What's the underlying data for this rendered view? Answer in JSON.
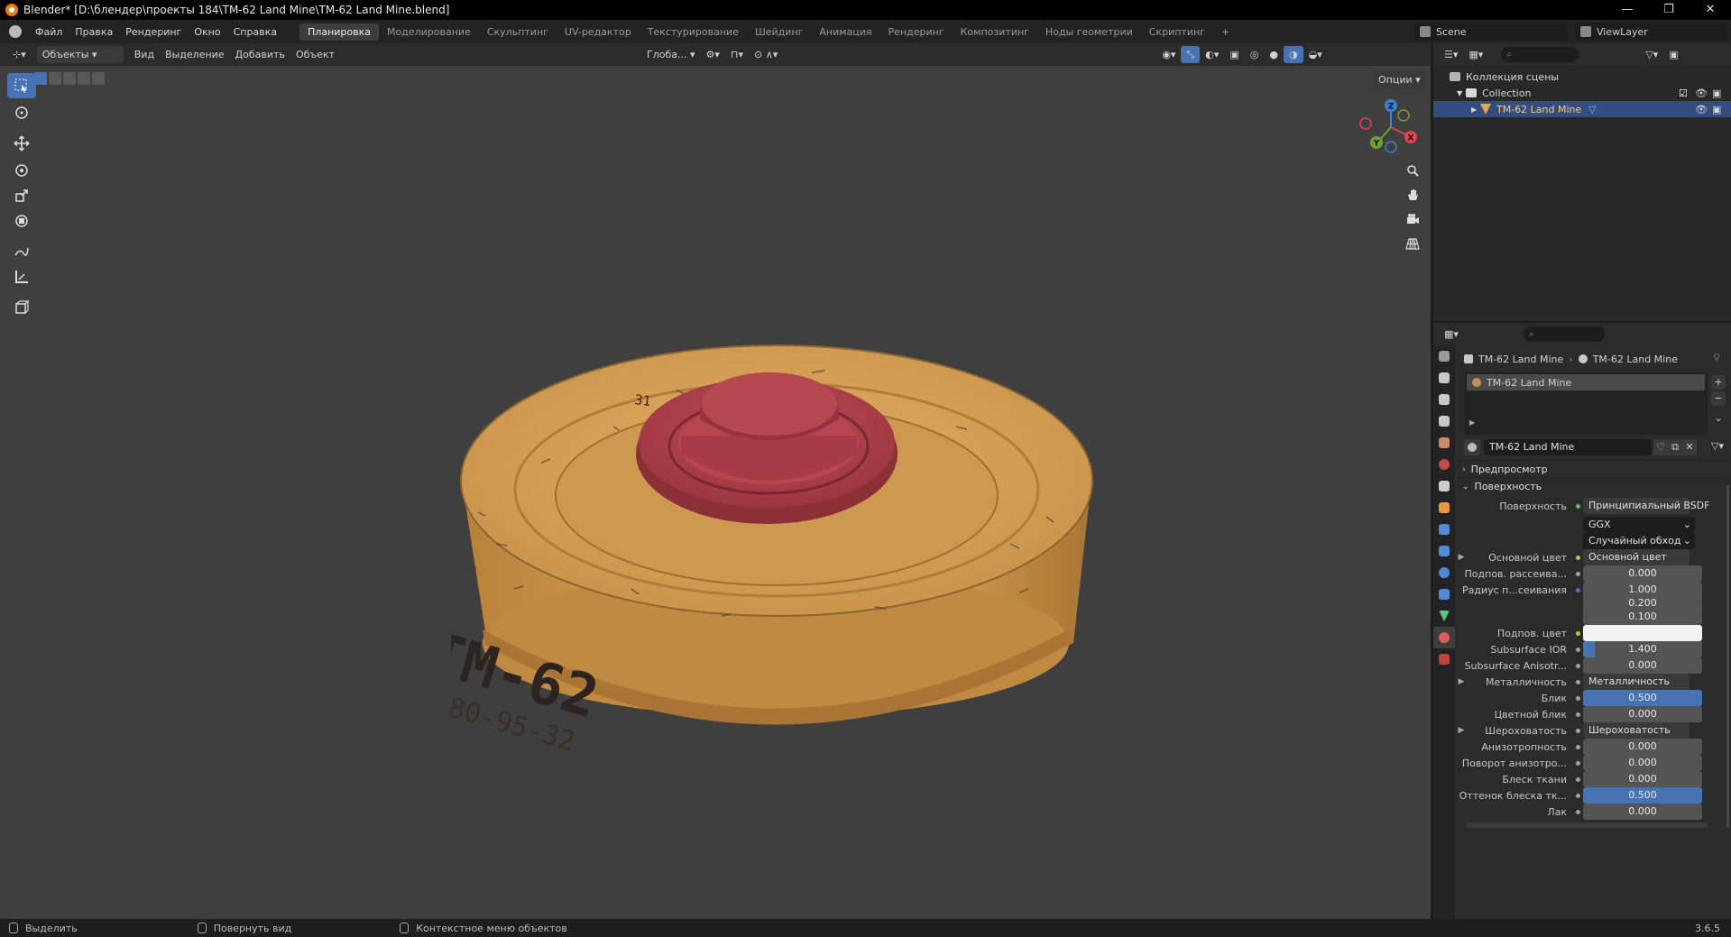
{
  "window": {
    "title": "Blender* [D:\\блендер\\проекты 184\\TM-62 Land Mine\\TM-62 Land Mine.blend]",
    "minimize_glyph": "—",
    "maximize_glyph": "❐",
    "close_glyph": "✕"
  },
  "menu": {
    "items": [
      "Файл",
      "Правка",
      "Рендеринг",
      "Окно",
      "Справка"
    ],
    "workspaces": [
      "Планировка",
      "Моделирование",
      "Скульптинг",
      "UV-редактор",
      "Текстурирование",
      "Шейдинг",
      "Анимация",
      "Рендеринг",
      "Композитинг",
      "Ноды геометрии",
      "Скриптинг"
    ],
    "active_workspace": "Планировка",
    "add_tab": "+",
    "scene": "Scene",
    "view_layer": "ViewLayer"
  },
  "viewport_header": {
    "mode": "Объекты",
    "menus": [
      "Вид",
      "Выделение",
      "Добавить",
      "Объект"
    ],
    "orientation": "Глоба...",
    "options": "Опции"
  },
  "model": {
    "label_main": "TM-62",
    "label_serial": "80-95-32",
    "label_top": "31",
    "body_color": "#d9a24e",
    "fuse_color": "#b8454c"
  },
  "gizmo": {
    "x": "X",
    "y": "Y",
    "z": "Z",
    "x_color": "#e0424f",
    "y_color": "#6ea12d",
    "z_color": "#3c82d4"
  },
  "outliner": {
    "scene_collection": "Коллекция сцены",
    "collection": "Collection",
    "object": "TM-62 Land Mine"
  },
  "properties": {
    "breadcrumb_object": "TM-62 Land Mine",
    "breadcrumb_material": "TM-62 Land Mine",
    "slot": "TM-62 Land Mine",
    "material_name": "TM-62 Land Mine",
    "section_preview": "Предпросмотр",
    "section_surface": "Поверхность",
    "rows": {
      "surface": {
        "label": "Поверхность",
        "value": "Принципиальный BSDF"
      },
      "distribution": "GGX",
      "sss_method": "Случайный обход",
      "base_color": {
        "label": "Основной цвет",
        "value": "Основной цвет"
      },
      "subsurface": {
        "label": "Подпов. рассеива...",
        "value": "0.000"
      },
      "subsurface_radius": {
        "label": "Радиус п...сеивания",
        "values": [
          "1.000",
          "0.200",
          "0.100"
        ]
      },
      "subsurface_color": {
        "label": "Подпов. цвет",
        "color": "#f2f2f2"
      },
      "subsurface_ior": {
        "label": "Subsurface IOR",
        "value": "1.400",
        "fill": 0.1
      },
      "subsurface_aniso": {
        "label": "Subsurface Anisotr...",
        "value": "0.000"
      },
      "metallic": {
        "label": "Металличность",
        "value": "Металличность"
      },
      "specular": {
        "label": "Блик",
        "value": "0.500",
        "fill": 1.0
      },
      "specular_tint": {
        "label": "Цветной блик",
        "value": "0.000"
      },
      "roughness": {
        "label": "Шероховатость",
        "value": "Шероховатость"
      },
      "anisotropic": {
        "label": "Анизотропность",
        "value": "0.000"
      },
      "aniso_rotation": {
        "label": "Поворот анизотро...",
        "value": "0.000"
      },
      "sheen": {
        "label": "Блеск ткани",
        "value": "0.000"
      },
      "sheen_tint": {
        "label": "Оттенок блеска тк...",
        "value": "0.500",
        "fill": 1.0
      },
      "clearcoat": {
        "label": "Лак",
        "value": "0.000"
      }
    }
  },
  "status": {
    "select": "Выделить",
    "rotate": "Повернуть вид",
    "context": "Контекстное меню объектов",
    "version": "3.6.5"
  }
}
